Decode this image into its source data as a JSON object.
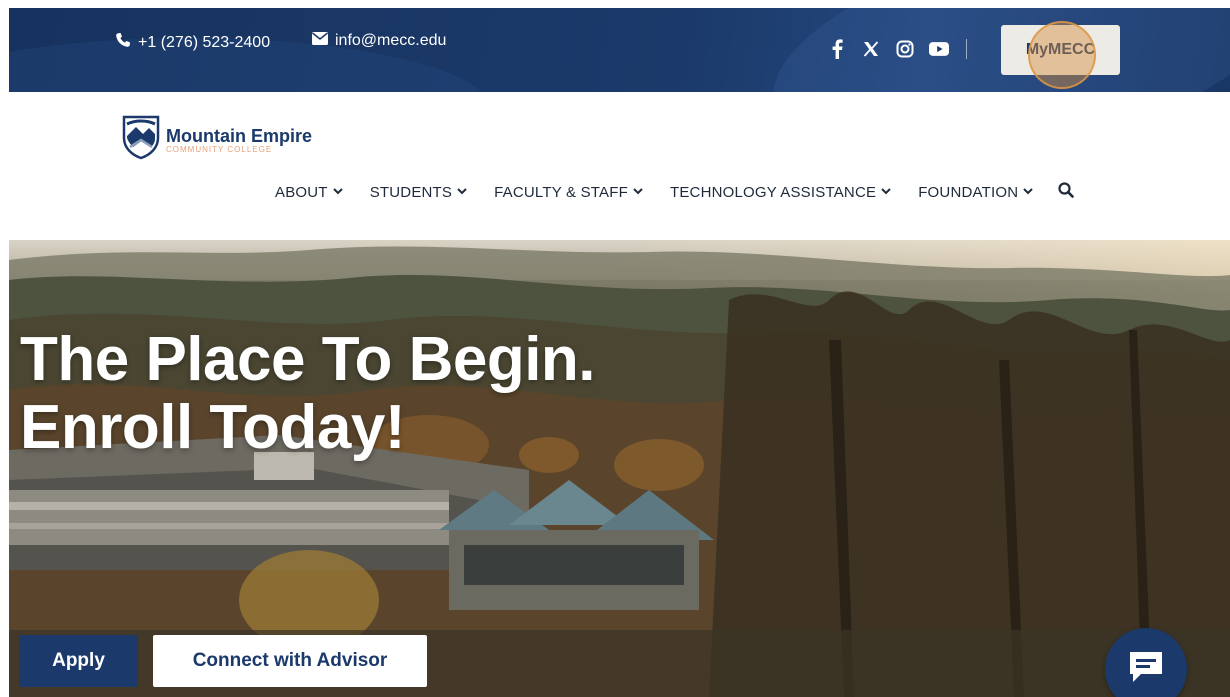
{
  "topbar": {
    "phone": "+1 (276) 523-2400",
    "email": "info@mecc.edu",
    "social_icons": [
      "facebook-icon",
      "x-icon",
      "instagram-icon",
      "youtube-icon"
    ],
    "portal_label": "MyMECC"
  },
  "header": {
    "logo_name": "Mountain Empire",
    "logo_sub": "COMMUNITY COLLEGE",
    "nav": [
      {
        "label": "ABOUT"
      },
      {
        "label": "STUDENTS"
      },
      {
        "label": "FACULTY & STAFF"
      },
      {
        "label": "TECHNOLOGY ASSISTANCE"
      },
      {
        "label": "FOUNDATION"
      }
    ]
  },
  "hero": {
    "headline_line1": "The Place To Begin.",
    "headline_line2": "Enroll Today!",
    "apply_label": "Apply",
    "advisor_label": "Connect with Advisor"
  },
  "colors": {
    "brand_navy": "#1b3a6b",
    "accent_orange": "#e5a27a"
  }
}
